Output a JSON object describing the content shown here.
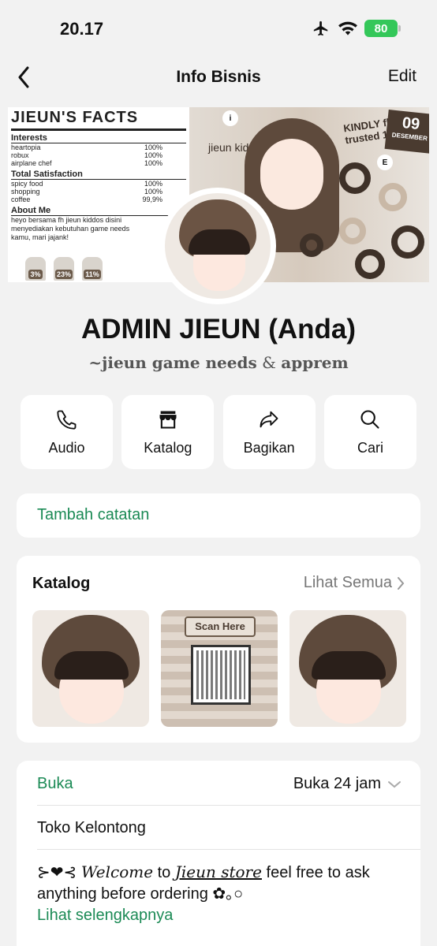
{
  "status_bar": {
    "time": "20.17",
    "battery": "80"
  },
  "nav": {
    "title": "Info Bisnis",
    "edit_label": "Edit"
  },
  "cover": {
    "facts_title": "JIEUN'S FACTS",
    "interests_label": "Interests",
    "interests": [
      {
        "name": "heartopia",
        "value": "100%"
      },
      {
        "name": "robux",
        "value": "100%"
      },
      {
        "name": "airplane chef",
        "value": "100%"
      }
    ],
    "satisfaction_label": "Total Satisfaction",
    "satisfaction": [
      {
        "name": "spicy food",
        "value": "100%"
      },
      {
        "name": "shopping",
        "value": "100%"
      },
      {
        "name": "coffee",
        "value": "99,9%"
      }
    ],
    "about_label": "About Me",
    "about_text": "heyo bersama fh jieun kiddos disini menyediakan kebutuhan game needs kamu, mari jajank!",
    "stats": [
      "3%",
      "23%",
      "11%"
    ],
    "brand_text": "jieun kiddos",
    "kindly_text": "KINDLY fh trusted 100%",
    "date_text": "09",
    "date_month": "DESEMBER"
  },
  "profile": {
    "name": "ADMIN JIEUN (Anda)",
    "desc_part1": "~jieun game needs",
    "desc_amp": "&",
    "desc_part2": "apprem"
  },
  "actions": [
    {
      "label": "Audio",
      "icon": "phone-icon"
    },
    {
      "label": "Katalog",
      "icon": "store-icon"
    },
    {
      "label": "Bagikan",
      "icon": "share-icon"
    },
    {
      "label": "Cari",
      "icon": "search-icon"
    }
  ],
  "note": {
    "label": "Tambah catatan"
  },
  "catalog": {
    "title": "Katalog",
    "see_all": "Lihat Semua",
    "qr_heading": "Scan Here"
  },
  "info": {
    "open_label": "Buka",
    "open_status": "Buka 24 jam",
    "category": "Toko Kelontong",
    "desc_prefix": "⊱❤⊰",
    "desc_welcome": "Welcome",
    "desc_to": " to ",
    "desc_store": "Jieun store",
    "desc_rest": " feel free to ask anything before ordering ✿｡○",
    "see_more": "Lihat selengkapnya"
  },
  "colors": {
    "accent_green": "#1b8a55",
    "battery_green": "#34c759"
  }
}
